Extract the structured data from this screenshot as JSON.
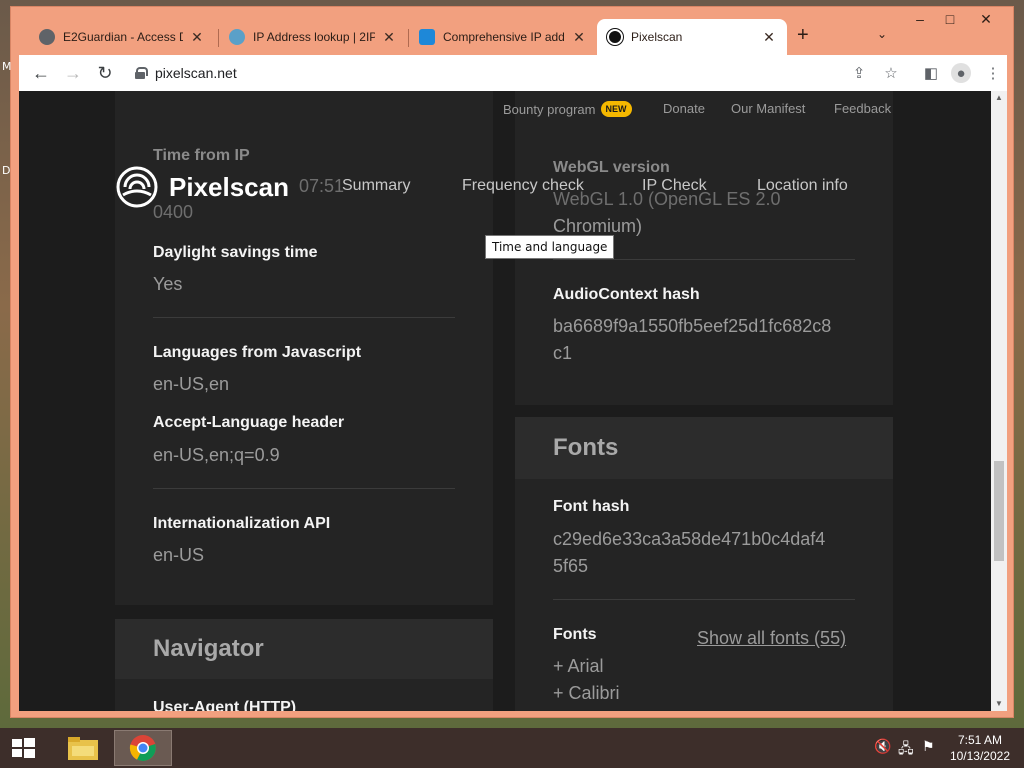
{
  "browser": {
    "tabs": [
      {
        "title": "E2Guardian - Access De",
        "icon": "globe-icon"
      },
      {
        "title": "IP Address lookup | 2IP",
        "icon": "gear-globe-icon"
      },
      {
        "title": "Comprehensive IP add",
        "icon": "location-pin-icon"
      },
      {
        "title": "Pixelscan",
        "icon": "pixelscan-icon"
      }
    ],
    "url": "pixelscan.net"
  },
  "header": {
    "top_links": [
      "Bounty program",
      "Donate",
      "Our Manifest",
      "Feedback"
    ],
    "new_badge": "NEW",
    "logo_text": "Pixelscan",
    "nav": [
      "Summary",
      "Frequency check",
      "IP Check",
      "Location info"
    ]
  },
  "left_panel": {
    "time_from_ip_label": "Time from IP",
    "time_from_ip_value_line1": "07:51",
    "time_from_ip_value_line2": "0400",
    "dst_label": "Daylight savings time",
    "dst_value": "Yes",
    "languages_js_label": "Languages from Javascript",
    "languages_js_value": "en-US,en",
    "accept_language_label": "Accept-Language header",
    "accept_language_value": "en-US,en;q=0.9",
    "intl_label": "Internationalization API",
    "intl_value": "en-US"
  },
  "navigator_panel": {
    "title": "Navigator",
    "user_agent_label": "User-Agent (HTTP)"
  },
  "right_panel": {
    "webgl_version_label": "WebGL version",
    "webgl_version_value_line1": "WebGL 1.0 (OpenGL ES 2.0",
    "webgl_version_value_line2": "Chromium)",
    "audio_label": "AudioContext hash",
    "audio_value_line1": "ba6689f9a1550fb5eef25d1fc682c8",
    "audio_value_line2": "c1"
  },
  "fonts_panel": {
    "title": "Fonts",
    "font_hash_label": "Font hash",
    "font_hash_value_line1": "c29ed6e33ca3a58de471b0c4daf4",
    "font_hash_value_line2": "5f65",
    "fonts_label": "Fonts",
    "show_all_link": "Show all fonts (55)",
    "font_items": [
      "+ Arial",
      "+ Calibri"
    ]
  },
  "tooltip": "Time and language",
  "taskbar": {
    "time": "7:51 AM",
    "date": "10/13/2022"
  }
}
